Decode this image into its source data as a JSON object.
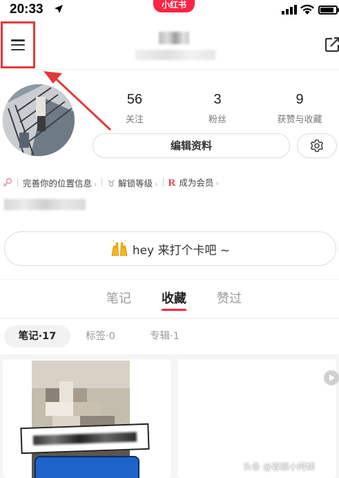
{
  "status_bar": {
    "time": "20:33",
    "app_badge": "小红书",
    "battery_level": 0.85
  },
  "header": {
    "menu_icon": "menu-icon",
    "share_icon": "share-icon"
  },
  "profile": {
    "stats": [
      {
        "value": "56",
        "label": "关注"
      },
      {
        "value": "3",
        "label": "粉丝"
      },
      {
        "value": "9",
        "label": "获赞与收藏"
      }
    ],
    "edit_button": "编辑资料",
    "settings_icon": "gear-icon",
    "info_items": [
      {
        "label": "完善你的位置信息"
      },
      {
        "label": "解锁等级"
      },
      {
        "label": "成为会员"
      }
    ],
    "checkin_label": "hey 来打个卡吧 ~"
  },
  "tabs": [
    {
      "label": "笔记",
      "active": false
    },
    {
      "label": "收藏",
      "active": true
    },
    {
      "label": "赞过",
      "active": false
    }
  ],
  "subtabs": [
    {
      "label": "笔记·17",
      "active": true
    },
    {
      "label": "标签·0",
      "active": false
    },
    {
      "label": "专辑·1",
      "active": false
    }
  ],
  "watermark": "头条 @容颜小阿姨",
  "colors": {
    "brand": "#ff2442",
    "annotation": "#e5383b"
  }
}
